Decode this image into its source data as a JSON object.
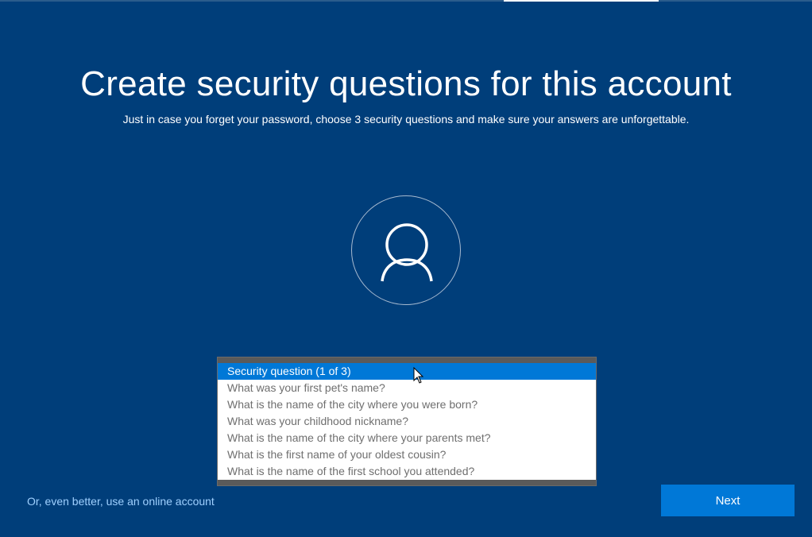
{
  "header": {
    "title": "Create security questions for this account",
    "subtitle": "Just in case you forget your password, choose 3 security questions and make sure your answers are unforgettable."
  },
  "avatar": {
    "icon": "user-icon"
  },
  "security_question": {
    "selected": "Security question (1 of 3)",
    "options": [
      "Security question (1 of 3)",
      "What was your first pet's name?",
      "What is the name of the city where you were born?",
      "What was your childhood nickname?",
      "What is the name of the city where your parents met?",
      "What is the first name of your oldest cousin?",
      "What is the name of the first school you attended?"
    ]
  },
  "footer": {
    "online_account_link": "Or, even better, use an online account",
    "next_label": "Next"
  },
  "colors": {
    "background": "#003e7a",
    "accent": "#0078d7",
    "link": "#9fd0ff"
  }
}
